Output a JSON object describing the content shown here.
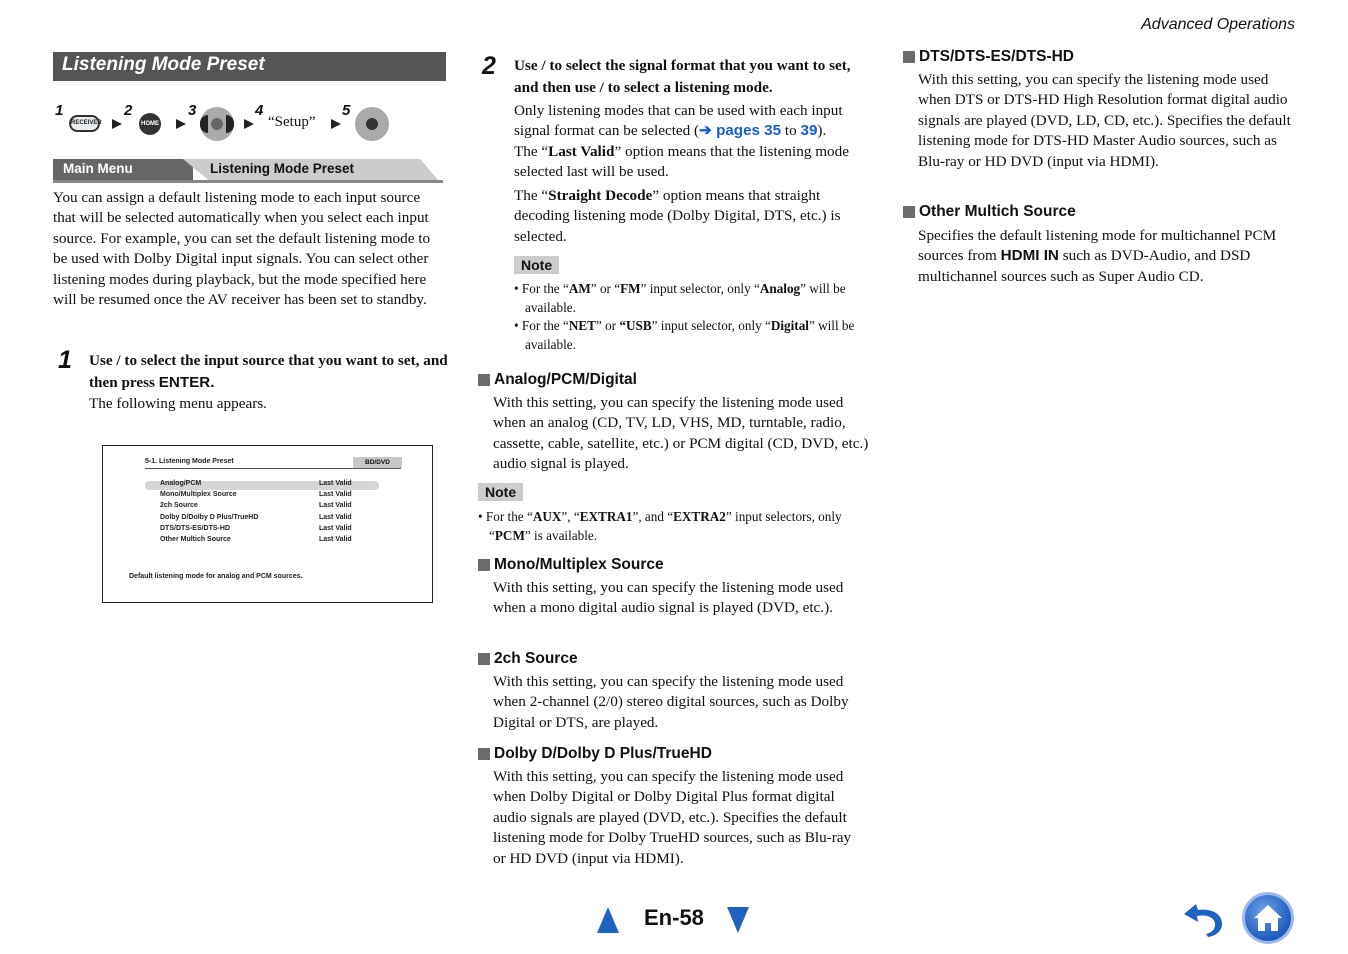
{
  "header": {
    "section": "Advanced Operations"
  },
  "title": "Listening Mode Preset",
  "steps_row": {
    "items": [
      {
        "num": "1",
        "button": "RECEIVER",
        "icon": "receiver-button-icon"
      },
      {
        "num": "2",
        "button": "HOME",
        "icon": "home-button-icon"
      },
      {
        "num": "3",
        "icon": "dpad-left-right-icon"
      },
      {
        "num": "4",
        "text": "“Setup”"
      },
      {
        "num": "5",
        "icon": "dpad-enter-icon"
      }
    ]
  },
  "menu_bar": {
    "main": "Main Menu",
    "current": "Listening Mode Preset"
  },
  "intro": "You can assign a default listening mode to each input source that will be selected automatically when you select each input source. For example, you can set the default listening mode to be used with Dolby Digital input signals. You can select other listening modes during playback, but the mode specified here will be resumed once the AV receiver has been set to standby.",
  "step1": {
    "num": "1",
    "head_a": "Use   /   to select the input source that you want to set, and then press ",
    "head_key": "ENTER.",
    "body": "The following menu appears."
  },
  "screen": {
    "title": "5-1. Listening Mode Preset",
    "badge": "BD/DVD",
    "items": [
      {
        "label": "Analog/PCM",
        "value": "Last Valid"
      },
      {
        "label": "Mono/Multiplex Source",
        "value": "Last Valid"
      },
      {
        "label": "2ch Source",
        "value": "Last Valid"
      },
      {
        "label": "Dolby D/Dolby D Plus/TrueHD",
        "value": "Last Valid"
      },
      {
        "label": "DTS/DTS-ES/DTS-HD",
        "value": "Last Valid"
      },
      {
        "label": "Other Multich Source",
        "value": "Last Valid"
      }
    ],
    "footer": "Default listening mode for analog and PCM sources."
  },
  "step2": {
    "num": "2",
    "head": "Use   /   to select the signal format that you want to set, and then use   /   to select a listening mode.",
    "p1_a": "Only listening modes that can be used with each input signal format can be selected (",
    "p1_link1": "➔ pages 35",
    "p1_to": " to ",
    "p1_link2": "39",
    "p1_end": ").",
    "p2_a": "The “",
    "p2_b": "Last Valid",
    "p2_c": "” option means that the listening mode selected last will be used.",
    "p3_a": "The “",
    "p3_b": "Straight Decode",
    "p3_c": "” option means that straight decoding listening mode (Dolby Digital, DTS, etc.) is selected."
  },
  "note1": {
    "label": "Note",
    "items": [
      [
        "For the “",
        "AM",
        "” or “",
        "FM",
        "” input selector, only “",
        "Analog",
        "” will be available."
      ],
      [
        "For the “",
        "NET",
        "” or ",
        "“USB",
        "” input selector, only “",
        "Digital",
        "” will be available."
      ]
    ]
  },
  "sections": [
    {
      "title": "Analog/PCM/Digital",
      "body": "With this setting, you can specify the listening mode used when an analog (CD, TV, LD, VHS, MD, turntable, radio, cassette, cable, satellite, etc.) or PCM digital (CD, DVD, etc.) audio signal is played."
    },
    {
      "title": "Mono/Multiplex Source",
      "body": "With this setting, you can specify the listening mode used when a mono digital audio signal is played (DVD, etc.)."
    },
    {
      "title": "2ch Source",
      "body": "With this setting, you can specify the listening mode used when 2-channel (2/0) stereo digital sources, such as Dolby Digital or DTS, are played."
    },
    {
      "title": "Dolby D/Dolby D Plus/TrueHD",
      "body": "With this setting, you can specify the listening mode used when Dolby Digital or Dolby Digital Plus format digital audio signals are played (DVD, etc.). Specifies the default listening mode for Dolby TrueHD sources, such as Blu-ray or HD DVD (input via HDMI)."
    },
    {
      "title": "DTS/DTS-ES/DTS-HD",
      "body": "With this setting, you can specify the listening mode used when DTS or DTS-HD High Resolution format digital audio signals are played (DVD, LD, CD, etc.). Specifies the default listening mode for DTS-HD Master Audio sources, such as Blu-ray or HD DVD (input via HDMI)."
    },
    {
      "title": "Other Multich Source",
      "body_a": "Specifies the default listening mode for multichannel PCM sources from ",
      "body_b": "HDMI IN",
      "body_c": " such as DVD-Audio, and DSD multichannel sources such as Super Audio CD."
    }
  ],
  "note2": {
    "label": "Note",
    "item": [
      "For the “",
      "AUX",
      "”, “",
      "EXTRA1",
      "”, and “",
      "EXTRA2",
      "” input selectors, only “",
      "PCM",
      "” is available."
    ]
  },
  "footer": {
    "page": "En-58"
  },
  "colors": {
    "accent": "#1e63bf",
    "title_bar": "#555555",
    "note_bg": "#cccccc"
  }
}
